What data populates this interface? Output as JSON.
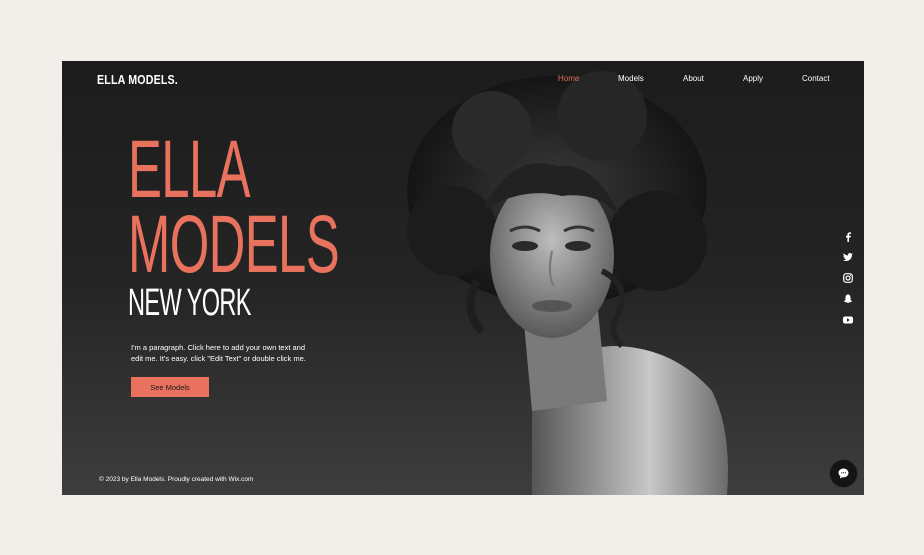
{
  "brand": {
    "logo": "ELLA MODELS."
  },
  "nav": {
    "items": [
      {
        "label": "Home",
        "active": true
      },
      {
        "label": "Models",
        "active": false
      },
      {
        "label": "About",
        "active": false
      },
      {
        "label": "Apply",
        "active": false
      },
      {
        "label": "Contact",
        "active": false
      }
    ]
  },
  "hero": {
    "line1": "ELLA",
    "line2": "MODELS",
    "line3": "NEW YORK",
    "paragraph": "I'm a paragraph. Click here to add your own text and edit me. It's easy. click \"Edit Text\" or double click me.",
    "cta_label": "See Models"
  },
  "footer": {
    "text": "© 2023 by Ella Models. Proudly created with Wix.com"
  },
  "social": [
    "facebook-icon",
    "twitter-icon",
    "instagram-icon",
    "snapchat-icon",
    "youtube-icon"
  ],
  "colors": {
    "accent": "#e8725e",
    "background": "#1e1e1e",
    "page": "#f2eee9"
  }
}
